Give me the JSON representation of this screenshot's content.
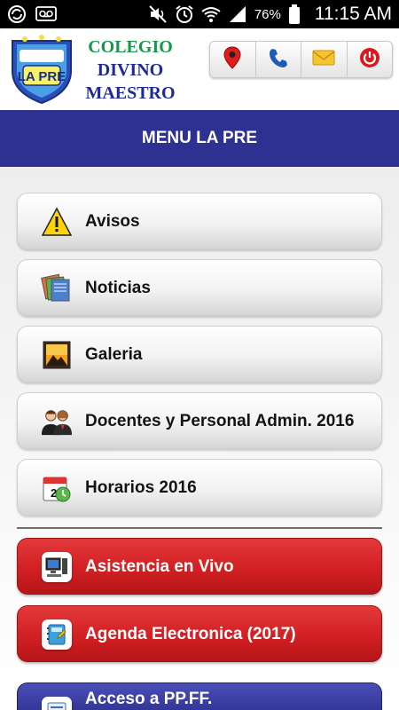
{
  "status_bar": {
    "battery": "76%",
    "time": "11:15 AM",
    "icons": [
      "sync-icon",
      "voicemail-icon",
      "mute-icon",
      "alarm-icon",
      "wifi-icon",
      "signal-icon",
      "battery-icon"
    ]
  },
  "header": {
    "school_line1": "COLEGIO",
    "school_line2": "DIVINO",
    "school_line3": "MAESTRO",
    "logo_text": "LA PRE",
    "toolbar": [
      "location-pin-icon",
      "phone-icon",
      "mail-icon",
      "power-icon"
    ]
  },
  "title": "MENU LA PRE",
  "menu": {
    "items": [
      {
        "label": "Avisos",
        "icon": "warning-icon",
        "style": "gray"
      },
      {
        "label": "Noticias",
        "icon": "news-icon",
        "style": "gray"
      },
      {
        "label": "Galeria",
        "icon": "gallery-icon",
        "style": "gray"
      },
      {
        "label": "Docentes y Personal Admin. 2016",
        "icon": "people-icon",
        "style": "gray"
      },
      {
        "label": "Horarios 2016",
        "icon": "calendar-icon",
        "style": "gray"
      },
      {
        "label": "Asistencia en Vivo",
        "icon": "computer-icon",
        "style": "red"
      },
      {
        "label": "Agenda Electronica (2017)",
        "icon": "notebook-icon",
        "style": "red"
      },
      {
        "label": "Acceso a PP.FF.",
        "icon": "form-icon",
        "style": "blue"
      }
    ]
  },
  "colors": {
    "brand_blue": "#2e3192",
    "brand_red": "#d42124",
    "brand_green": "#16984a"
  }
}
